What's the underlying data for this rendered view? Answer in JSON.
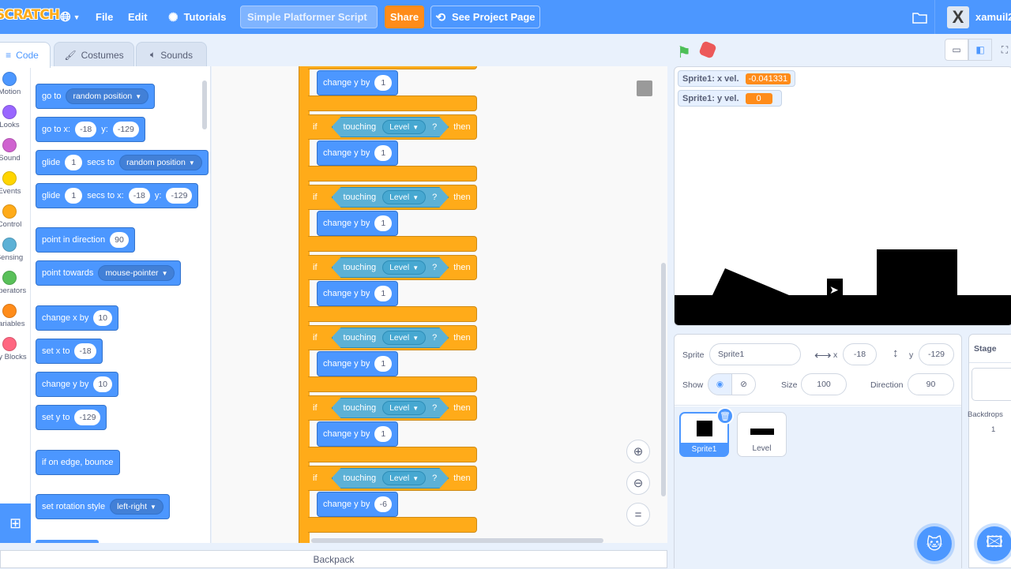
{
  "menubar": {
    "logo": "SCRATCH",
    "file": "File",
    "edit": "Edit",
    "tutorials": "Tutorials",
    "project_title": "Simple Platformer Script",
    "share": "Share",
    "see_project_page": "See Project Page",
    "username": "xamuil2"
  },
  "tabs": {
    "code": "Code",
    "costumes": "Costumes",
    "sounds": "Sounds"
  },
  "categories": [
    {
      "label": "Motion",
      "color": "#4c97ff"
    },
    {
      "label": "Looks",
      "color": "#9966ff"
    },
    {
      "label": "Sound",
      "color": "#cf63cf"
    },
    {
      "label": "Events",
      "color": "#ffd500"
    },
    {
      "label": "Control",
      "color": "#ffab19"
    },
    {
      "label": "Sensing",
      "color": "#5cb1d6"
    },
    {
      "label": "Operators",
      "color": "#59c059"
    },
    {
      "label": "Variables",
      "color": "#ff8c1a"
    },
    {
      "label": "My Blocks",
      "color": "#ff6680"
    }
  ],
  "palette": {
    "goto_text": "go to",
    "goto_dd": "random position",
    "gotoxy_text": "go to x:",
    "gotoxy_x": "-18",
    "gotoxy_y_lbl": "y:",
    "gotoxy_y": "-129",
    "glide1_text": "glide",
    "glide1_secs": "1",
    "glide1_mid": "secs to",
    "glide1_dd": "random position",
    "glide2_text": "glide",
    "glide2_secs": "1",
    "glide2_mid": "secs to x:",
    "glide2_x": "-18",
    "glide2_y_lbl": "y:",
    "glide2_y": "-129",
    "point_dir_text": "point in direction",
    "point_dir_val": "90",
    "point_towards_text": "point towards",
    "point_towards_dd": "mouse-pointer",
    "change_x_text": "change x by",
    "change_x_val": "10",
    "set_x_text": "set x to",
    "set_x_val": "-18",
    "change_y_text": "change y by",
    "change_y_val": "10",
    "set_y_text": "set y to",
    "set_y_val": "-129",
    "bounce_text": "if on edge, bounce",
    "rot_text": "set rotation style",
    "rot_dd": "left-right"
  },
  "script": {
    "if_label": "if",
    "then_label": "then",
    "touching": "touching",
    "target": "Level",
    "q": "?",
    "change_y_label": "change y by",
    "change_values": [
      "1",
      "1",
      "1",
      "1",
      "1",
      "1",
      "-6"
    ]
  },
  "monitors": [
    {
      "label": "Sprite1: x vel.",
      "value": "-0.041331"
    },
    {
      "label": "Sprite1: y vel.",
      "value": "0"
    }
  ],
  "sprite_info": {
    "sprite_lbl": "Sprite",
    "sprite_name": "Sprite1",
    "x_lbl": "x",
    "x_val": "-18",
    "y_lbl": "y",
    "y_val": "-129",
    "show_lbl": "Show",
    "size_lbl": "Size",
    "size_val": "100",
    "direction_lbl": "Direction",
    "direction_val": "90"
  },
  "sprites": [
    {
      "name": "Sprite1"
    },
    {
      "name": "Level"
    }
  ],
  "stage_pane": {
    "title": "Stage",
    "backdrops_lbl": "Backdrops",
    "backdrops_count": "1"
  },
  "backpack": "Backpack"
}
